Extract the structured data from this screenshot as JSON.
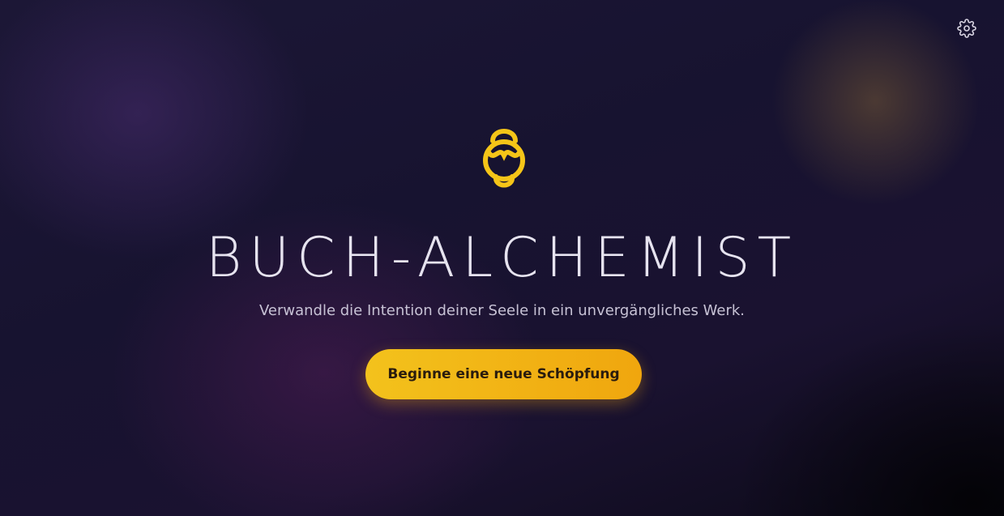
{
  "header": {
    "settings_icon": "gear-icon"
  },
  "hero": {
    "logo_icon": "alchemy-knot-icon",
    "title": "BUCH-ALCHEMIST",
    "subtitle": "Verwandle die Intention deiner Seele in ein unvergängliches Werk.",
    "cta_label": "Beginne eine neue Schöpfung"
  },
  "colors": {
    "accent": "#f3c21c",
    "accent_dark": "#f0a60e",
    "background": "#171330",
    "title_text": "#e6e3ef"
  }
}
